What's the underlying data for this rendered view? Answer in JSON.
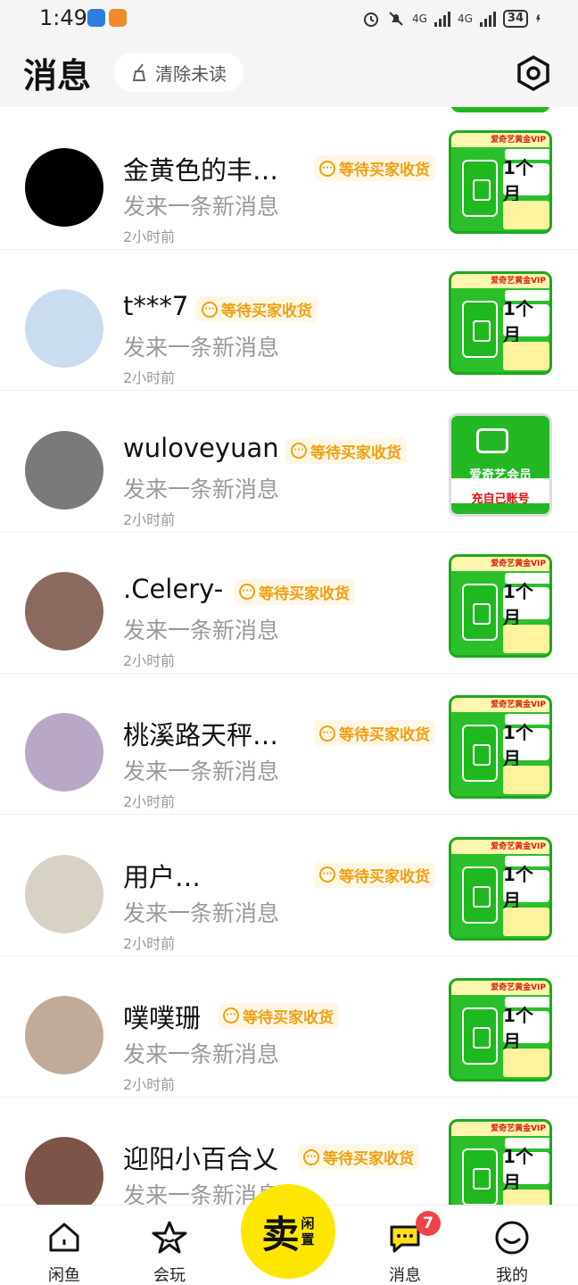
{
  "status_bar": {
    "time": "1:49",
    "signal1": "4G",
    "signal2": "4G",
    "battery": "34"
  },
  "header": {
    "title": "消息",
    "clear_unread": "清除未读"
  },
  "conversations": [
    {
      "name": "金黄色的丰…",
      "badge": "等待买家收货",
      "message": "发来一条新消息",
      "time": "2小时前",
      "avatar_color": "#000000",
      "thumb": "vip"
    },
    {
      "name": "t***7",
      "badge": "等待买家收货",
      "message": "发来一条新消息",
      "time": "2小时前",
      "avatar_color": "#c9dcf0",
      "thumb": "vip"
    },
    {
      "name": "wuloveyuan",
      "badge": "等待买家收货",
      "message": "发来一条新消息",
      "time": "2小时前",
      "avatar_color": "#7a7a7a",
      "thumb": "iqiyi"
    },
    {
      "name": ".Celery-",
      "badge": "等待买家收货",
      "message": "发来一条新消息",
      "time": "2小时前",
      "avatar_color": "#8a6a5e",
      "thumb": "vip"
    },
    {
      "name": "桃溪路天秤…",
      "badge": "等待买家收货",
      "message": "发来一条新消息",
      "time": "2小时前",
      "avatar_color": "#b9a7c8",
      "thumb": "vip"
    },
    {
      "name": "用户…",
      "badge": "等待买家收货",
      "message": "发来一条新消息",
      "time": "2小时前",
      "avatar_color": "#d8d2c4",
      "thumb": "vip"
    },
    {
      "name": "噗噗珊",
      "badge": "等待买家收货",
      "message": "发来一条新消息",
      "time": "2小时前",
      "avatar_color": "#c2aa98",
      "thumb": "vip"
    },
    {
      "name": "迎阳小百合乂",
      "badge": "等待买家收货",
      "message": "发来一条新消息",
      "time": "",
      "avatar_color": "#7c5548",
      "thumb": "vip"
    }
  ],
  "thumb_text": {
    "vip_header": "爱奇艺黄金VIP",
    "month": "1个月",
    "iqiyi_name": "爱奇艺会员",
    "iqiyi_sub": "充自己账号"
  },
  "tabs": {
    "home": "闲鱼",
    "play": "会玩",
    "sell_big": "卖",
    "sell_small_1": "闲",
    "sell_small_2": "置",
    "messages": "消息",
    "messages_count": "7",
    "mine": "我的"
  }
}
